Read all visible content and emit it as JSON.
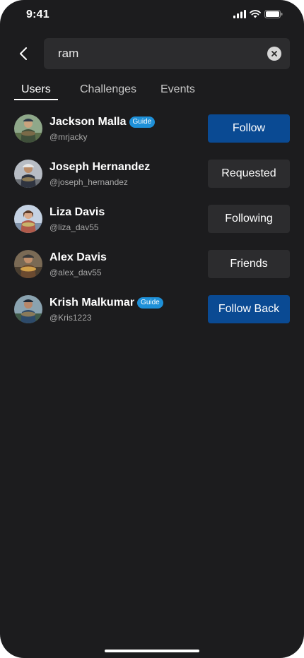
{
  "status_bar": {
    "time": "9:41"
  },
  "search": {
    "value": "ram",
    "placeholder": ""
  },
  "tabs": [
    {
      "label": "Users",
      "active": true
    },
    {
      "label": "Challenges",
      "active": false
    },
    {
      "label": "Events",
      "active": false
    }
  ],
  "users": [
    {
      "name": "Jackson Malla",
      "handle": "@mrjacky",
      "badge": "Guide",
      "action": "Follow",
      "action_style": "primary",
      "avatar_color": "#4d6b4a"
    },
    {
      "name": "Joseph Hernandez",
      "handle": "@joseph_hernandez",
      "badge": "",
      "action": "Requested",
      "action_style": "secondary",
      "avatar_color": "#8a8f96"
    },
    {
      "name": "Liza Davis",
      "handle": "@liza_dav55",
      "badge": "",
      "action": "Following",
      "action_style": "secondary",
      "avatar_color": "#9aa5b8"
    },
    {
      "name": "Alex Davis",
      "handle": "@alex_dav55",
      "badge": "",
      "action": "Friends",
      "action_style": "secondary",
      "avatar_color": "#6a5138"
    },
    {
      "name": "Krish Malkumar",
      "handle": "@Kris1223",
      "badge": "Guide",
      "action": "Follow Back",
      "action_style": "primary",
      "avatar_color": "#3e5a6e"
    }
  ],
  "colors": {
    "background": "#1c1c1e",
    "primary_button": "#0a4a93",
    "secondary_button": "#2c2c2e",
    "badge": "#1e90d8"
  },
  "icons": {
    "back": "chevron-left-icon",
    "clear": "clear-x-icon",
    "signal": "signal-icon",
    "wifi": "wifi-icon",
    "battery": "battery-icon"
  }
}
